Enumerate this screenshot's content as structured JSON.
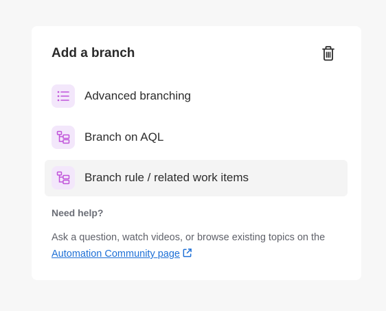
{
  "panel": {
    "title": "Add a branch",
    "delete_icon": "trash-icon"
  },
  "options": [
    {
      "label": "Advanced branching",
      "icon": "list-icon"
    },
    {
      "label": "Branch on AQL",
      "icon": "branch-icon"
    },
    {
      "label": "Branch rule / related work items",
      "icon": "branch-icon",
      "state": "hovered"
    }
  ],
  "help": {
    "title": "Need help?",
    "text_before": "Ask a question, watch videos, or browse existing topics on the ",
    "link_label": "Automation Community page",
    "link_icon": "external-link-icon"
  },
  "colors": {
    "icon_accent": "#c052d9",
    "icon_bg": "#f3e7fb",
    "link": "#1d6fd6"
  }
}
